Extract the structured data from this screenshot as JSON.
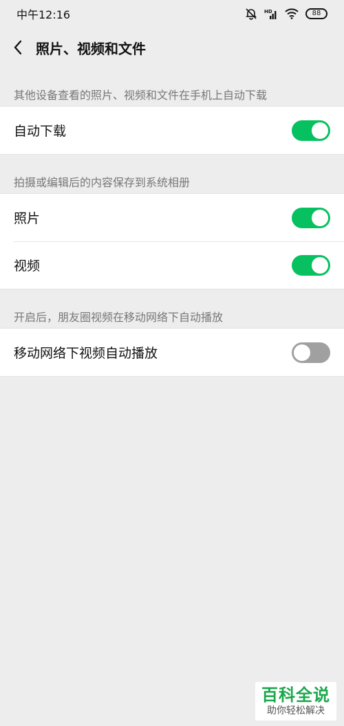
{
  "status_bar": {
    "time": "中午12:16",
    "icons": [
      "alarm-off-icon",
      "hd-signal-icon",
      "wifi-icon",
      "battery-icon"
    ],
    "hd_label": "HD",
    "battery": "88"
  },
  "header": {
    "title": "照片、视频和文件",
    "back_icon": "chevron-left-icon"
  },
  "sections": {
    "download": {
      "label": "其他设备查看的照片、视频和文件在手机上自动下载",
      "rows": [
        {
          "label": "自动下载",
          "on": true
        }
      ]
    },
    "save": {
      "label": "拍摄或编辑后的内容保存到系统相册",
      "rows": [
        {
          "label": "照片",
          "on": true
        },
        {
          "label": "视频",
          "on": true
        }
      ]
    },
    "autoplay": {
      "label": "开启后，朋友圈视频在移动网络下自动播放",
      "rows": [
        {
          "label": "移动网络下视频自动播放",
          "on": false
        }
      ]
    }
  },
  "watermark": {
    "main": "百科全说",
    "sub": "助你轻松解决"
  },
  "colors": {
    "toggle_on": "#07c160",
    "toggle_off": "#a0a0a0",
    "background": "#ededed"
  }
}
